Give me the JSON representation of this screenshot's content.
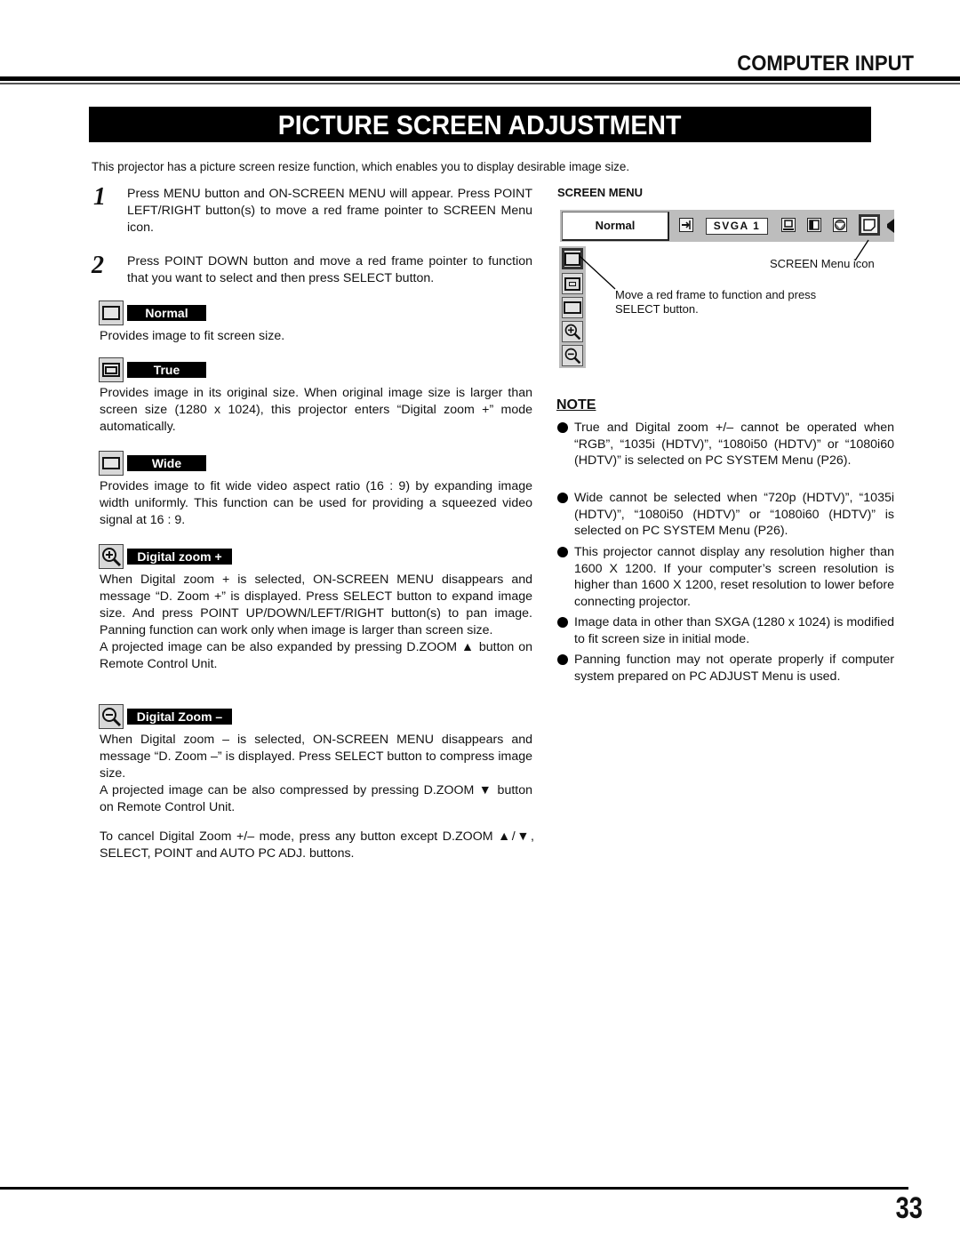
{
  "header": {
    "section": "COMPUTER INPUT",
    "title": "PICTURE SCREEN ADJUSTMENT"
  },
  "intro": "This projector has a picture screen resize function, which enables you to display desirable image size.",
  "steps": [
    {
      "number": "1",
      "text": "Press MENU button and ON-SCREEN MENU will appear.  Press POINT LEFT/RIGHT button(s) to move a red frame pointer to SCREEN Menu icon."
    },
    {
      "number": "2",
      "text": "Press POINT DOWN button and move a red frame pointer to function that you want to select and then press SELECT button."
    }
  ],
  "functions": [
    {
      "label": "Normal",
      "icon": "normal-screen-icon",
      "paragraphs": [
        "Provides image to fit screen size."
      ]
    },
    {
      "label": "True",
      "icon": "true-screen-icon",
      "paragraphs": [
        "Provides image in its original size.  When original image size is larger than screen size (1280 x 1024), this projector enters “Digital zoom +” mode automatically."
      ]
    },
    {
      "label": "Wide",
      "icon": "wide-screen-icon",
      "paragraphs": [
        "Provides image to fit wide video aspect ratio (16 : 9) by expanding image width uniformly.  This function can be used for providing a squeezed video signal at 16 : 9."
      ]
    },
    {
      "label": "Digital zoom +",
      "icon": "zoom-in-icon",
      "paragraphs": [
        "When Digital zoom + is selected, ON-SCREEN MENU disappears and message “D. Zoom +” is displayed.  Press SELECT button to expand image size.  And press POINT UP/DOWN/LEFT/RIGHT button(s) to pan image.  Panning function can work only when image is larger than screen size.",
        "A projected image can be also expanded by pressing D.ZOOM ▲ button on Remote Control Unit."
      ]
    },
    {
      "label": "Digital Zoom –",
      "icon": "zoom-out-icon",
      "paragraphs": [
        "When Digital zoom – is selected, ON-SCREEN MENU disappears and message “D. Zoom –” is displayed.  Press SELECT button to compress image size.",
        "A projected image can be also compressed by pressing D.ZOOM ▼ button on Remote Control Unit."
      ]
    }
  ],
  "cancel_note": "To cancel Digital Zoom +/– mode, press any button except D.ZOOM ▲/▼, SELECT, POINT and AUTO PC ADJ. buttons.",
  "screen_menu": {
    "heading": "SCREEN MENU",
    "mode_value": "Normal",
    "system_value": "SVGA 1",
    "callout_icon": "SCREEN Menu icon",
    "callout_frame": "Move a red frame to function and press SELECT button."
  },
  "note": {
    "heading": "NOTE",
    "items": [
      "True and Digital zoom +/– cannot be operated when “RGB”, “1035i (HDTV)”, “1080i50 (HDTV)” or “1080i60 (HDTV)” is selected on PC SYSTEM Menu  (P26).",
      "Wide cannot be selected when “720p (HDTV)”, “1035i (HDTV)”, “1080i50 (HDTV)” or “1080i60 (HDTV)” is selected on PC SYSTEM Menu  (P26).",
      "This projector cannot display any resolution higher than 1600 X 1200.  If your computer’s screen resolution is higher than 1600 X 1200, reset resolution to lower before connecting projector.",
      "Image data in other than SXGA (1280 x 1024) is modified to fit screen size in initial mode.",
      "Panning function may not operate properly if computer system prepared on PC ADJUST Menu is used."
    ]
  },
  "page_number": "33"
}
